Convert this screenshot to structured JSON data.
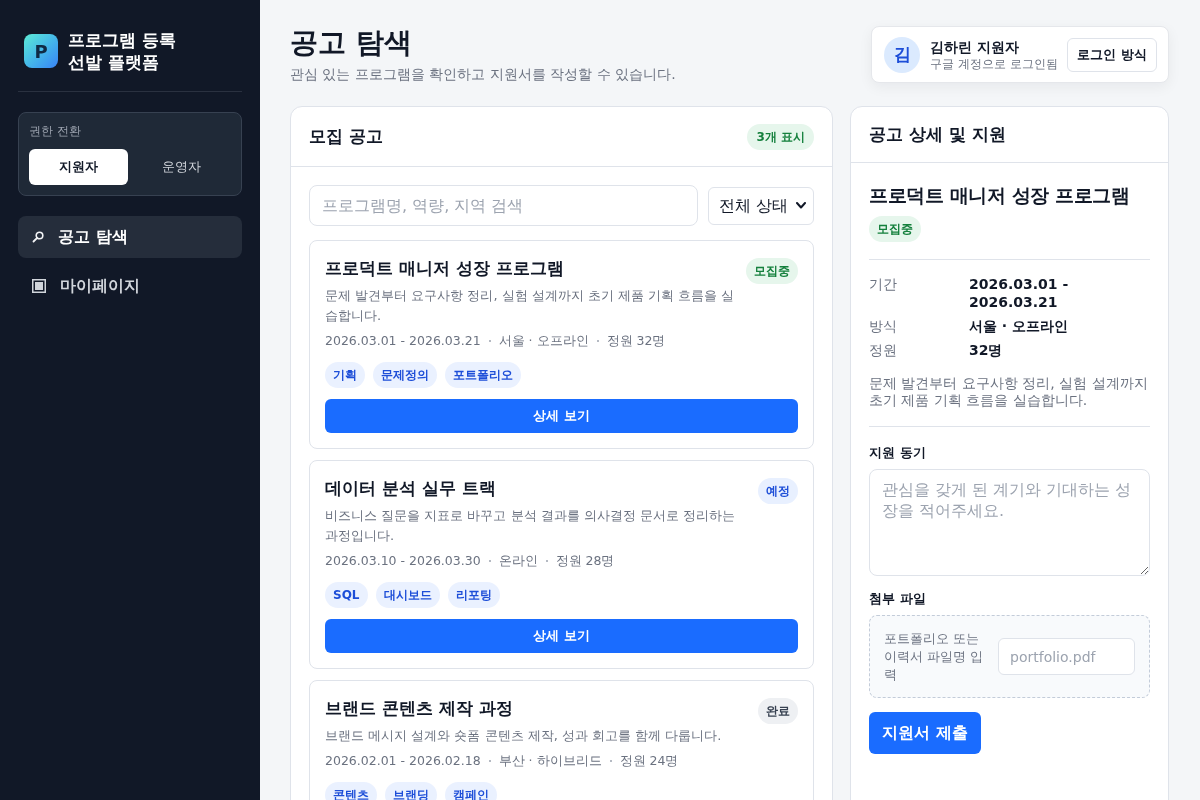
{
  "sidebar": {
    "logo": "P",
    "brand_lines": [
      "프로그램 등록",
      "선발 플랫폼"
    ],
    "role_switch": {
      "label": "권한 전환",
      "options": [
        {
          "label": "지원자",
          "selected": true
        },
        {
          "label": "운영자",
          "selected": false
        }
      ]
    },
    "nav": [
      {
        "label": "공고 탐색",
        "selected": true
      },
      {
        "label": "마이페이지",
        "selected": false
      }
    ]
  },
  "header": {
    "title": "공고 탐색",
    "subtitle": "관심 있는 프로그램을 확인하고 지원서를 작성할 수 있습니다."
  },
  "user": {
    "avatar": "김",
    "name": "김하린 지원자",
    "login_note": "구글 계정으로 로그인됨",
    "button": "로그인 방식"
  },
  "listings": {
    "title": "모집 공고",
    "count_badge": "3개 표시",
    "search": {
      "placeholder": "프로그램명, 역량, 지역 검색"
    },
    "status_filter": "전체 상태",
    "cards": [
      {
        "title": "프로덕트 매니저 성장 프로그램",
        "status": {
          "text": "모집중",
          "kind": "open"
        },
        "description": "문제 발견부터 요구사항 정리, 실험 설계까지 초기 제품 기획 흐름을 실습합니다.",
        "meta": [
          "2026.03.01 - 2026.03.21",
          "서울 · 오프라인",
          "정원 32명"
        ],
        "tags": [
          "기획",
          "문제정의",
          "포트폴리오"
        ],
        "button": "상세 보기"
      },
      {
        "title": "데이터 분석 실무 트랙",
        "status": {
          "text": "예정",
          "kind": "upcoming"
        },
        "description": "비즈니스 질문을 지표로 바꾸고 분석 결과를 의사결정 문서로 정리하는 과정입니다.",
        "meta": [
          "2026.03.10 - 2026.03.30",
          "온라인",
          "정원 28명"
        ],
        "tags": [
          "SQL",
          "대시보드",
          "리포팅"
        ],
        "button": "상세 보기"
      },
      {
        "title": "브랜드 콘텐츠 제작 과정",
        "status": {
          "text": "완료",
          "kind": "done"
        },
        "description": "브랜드 메시지 설계와 숏폼 콘텐츠 제작, 성과 회고를 함께 다룹니다.",
        "meta": [
          "2026.02.01 - 2026.02.18",
          "부산 · 하이브리드",
          "정원 24명"
        ],
        "tags": [
          "콘텐츠",
          "브랜딩",
          "캠페인"
        ]
      }
    ]
  },
  "detail": {
    "title": "공고 상세 및 지원",
    "program": {
      "title": "프로덕트 매니저 성장 프로그램",
      "status": {
        "text": "모집중",
        "kind": "open"
      },
      "fields": [
        {
          "label": "기간",
          "value": "2026.03.01 - 2026.03.21"
        },
        {
          "label": "방식",
          "value": "서울 · 오프라인"
        },
        {
          "label": "정원",
          "value": "32명"
        }
      ],
      "description": "문제 발견부터 요구사항 정리, 실험 설계까지 초기 제품 기획 흐름을 실습합니다."
    },
    "form": {
      "motivation": {
        "label": "지원 동기",
        "placeholder": "관심을 갖게 된 계기와 기대하는 성장을 적어주세요."
      },
      "attachment": {
        "label": "첨부 파일",
        "hint": "포트폴리오 또는 이력서 파일명 입력",
        "placeholder": "portfolio.pdf"
      },
      "submit": "지원서 제출"
    }
  }
}
